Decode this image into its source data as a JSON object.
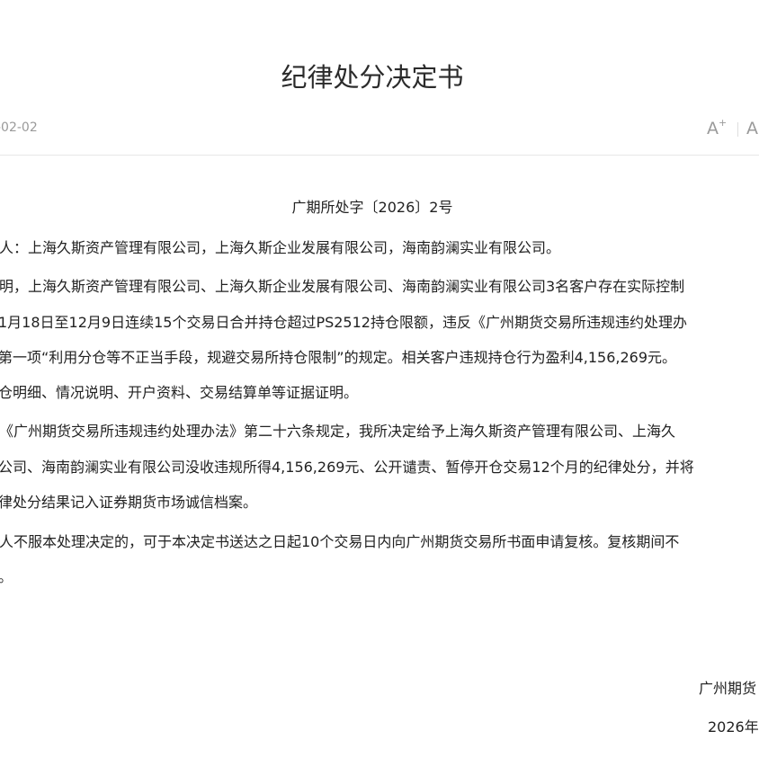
{
  "title": "纪律处分决定书",
  "date": "-02-02",
  "font_controls": {
    "increase_label": "A",
    "increase_mark": "+",
    "decrease_label": "A"
  },
  "doc_number": "广期所处字〔2026〕2号",
  "body_lines": [
    "人：上海久斯资产管理有限公司，上海久斯企业发展有限公司，海南韵澜实业有限公司。",
    "明，上海久斯资产管理有限公司、上海久斯企业发展有限公司、海南韵澜实业有限公司3名客户存在实际控制",
    "1月18日至12月9日连续15个交易日合并持仓超过PS2512持仓限额，违反《广州期货交易所违规违约处理办",
    "第一项“利用分仓等不正当手段，规避交易所持仓限制”的规定。相关客户违规持仓行为盈利4,156,269元。",
    "仓明细、情况说明、开户资料、交易结算单等证据证明。",
    "《广州期货交易所违规违约处理办法》第二十六条规定，我所决定给予上海久斯资产管理有限公司、上海久",
    "公司、海南韵澜实业有限公司没收违规所得4,156,269元、公开谴责、暂停开仓交易12个月的纪律处分，并将",
    "律处分结果记入证券期货市场诚信档案。",
    "人不服本处理决定的，可于本决定书送达之日起10个交易日内向广州期货交易所书面申请复核。复核期间不",
    "。"
  ],
  "signature": {
    "issuer": "广州期货",
    "date": "2026年"
  }
}
